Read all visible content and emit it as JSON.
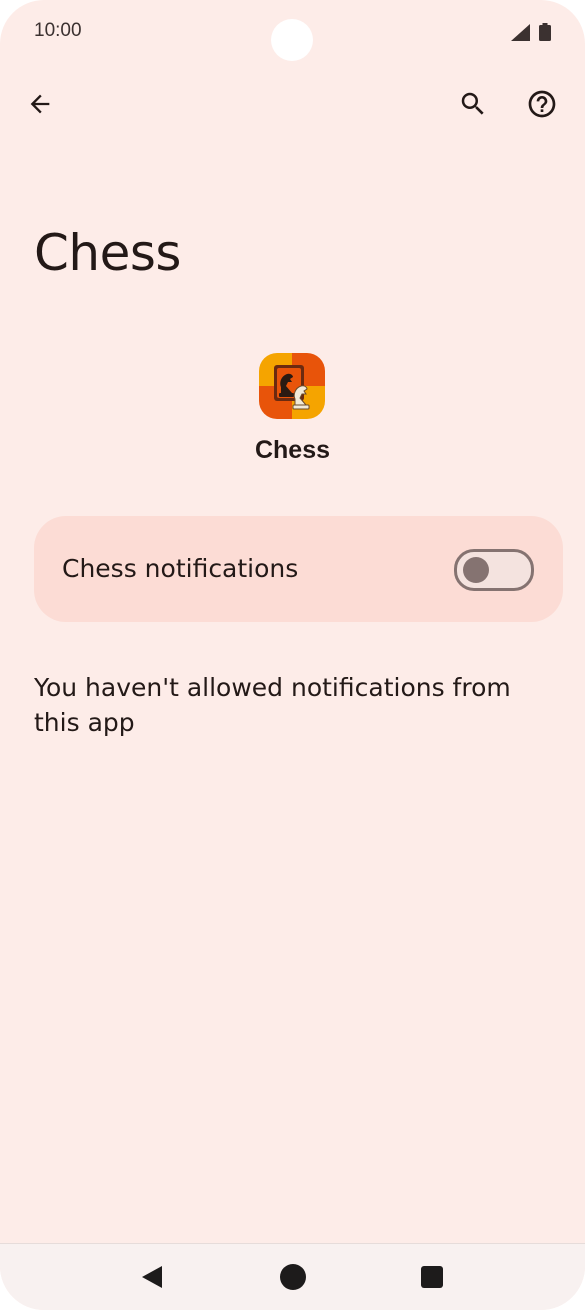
{
  "status_bar": {
    "time": "10:00",
    "icons": [
      "signal-icon",
      "battery-icon"
    ]
  },
  "top_bar": {
    "icons": [
      "back-arrow-icon",
      "search-icon",
      "help-icon"
    ]
  },
  "page": {
    "title": "Chess"
  },
  "app": {
    "name": "Chess",
    "icon": "chess-app-icon"
  },
  "notifications": {
    "label": "Chess notifications",
    "enabled": false
  },
  "message": "You haven't allowed notifications from this app",
  "nav_bar": {
    "icons": [
      "nav-back-icon",
      "nav-home-icon",
      "nav-recents-icon"
    ]
  },
  "colors": {
    "background": "#fdece8",
    "card": "#fcdcd5",
    "toggle_outline": "#857371",
    "text": "#231917"
  }
}
